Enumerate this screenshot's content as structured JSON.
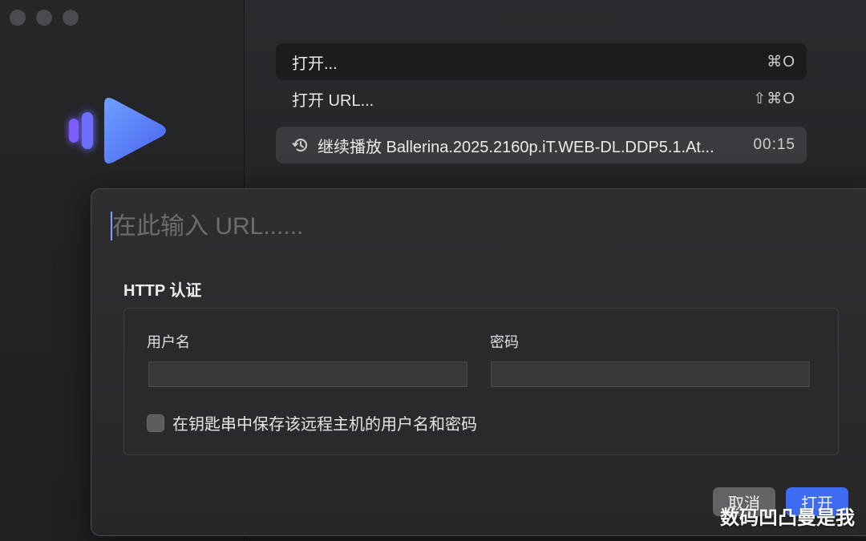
{
  "menu": {
    "open_label": "打开...",
    "open_shortcut": "⌘O",
    "open_url_label": "打开 URL...",
    "open_url_shortcut": "⇧⌘O",
    "resume_label": "继续播放 Ballerina.2025.2160p.iT.WEB-DL.DDP5.1.At...",
    "resume_time": "00:15"
  },
  "sheet": {
    "url_placeholder": "在此输入 URL......",
    "http_title": "HTTP 认证",
    "username_label": "用户名",
    "password_label": "密码",
    "save_checkbox_label": "在钥匙串中保存该远程主机的用户名和密码",
    "cancel_label": "取消",
    "open_label": "打开"
  },
  "watermark": "数码凹凸曼是我",
  "colors": {
    "accent": "#3d6cf2",
    "logo_blue": "#5b7bff",
    "logo_purple": "#7b5cff"
  }
}
